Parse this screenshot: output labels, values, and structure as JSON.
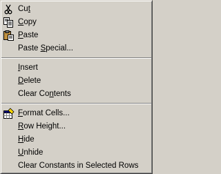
{
  "menu": {
    "items": [
      {
        "type": "item",
        "name": "menu-item-cut",
        "icon": "scissors-icon",
        "pre": "Cu",
        "key": "t",
        "post": ""
      },
      {
        "type": "item",
        "name": "menu-item-copy",
        "icon": "copy-icon",
        "pre": "",
        "key": "C",
        "post": "opy"
      },
      {
        "type": "item",
        "name": "menu-item-paste",
        "icon": "paste-icon",
        "pre": "",
        "key": "P",
        "post": "aste"
      },
      {
        "type": "item",
        "name": "menu-item-paste-special",
        "icon": null,
        "pre": "Paste ",
        "key": "S",
        "post": "pecial..."
      },
      {
        "type": "separator"
      },
      {
        "type": "item",
        "name": "menu-item-insert",
        "icon": null,
        "pre": "",
        "key": "I",
        "post": "nsert"
      },
      {
        "type": "item",
        "name": "menu-item-delete",
        "icon": null,
        "pre": "",
        "key": "D",
        "post": "elete"
      },
      {
        "type": "item",
        "name": "menu-item-clear-contents",
        "icon": null,
        "pre": "Clear Co",
        "key": "n",
        "post": "tents"
      },
      {
        "type": "separator"
      },
      {
        "type": "item",
        "name": "menu-item-format-cells",
        "icon": "format-cells-icon",
        "pre": "",
        "key": "F",
        "post": "ormat Cells..."
      },
      {
        "type": "item",
        "name": "menu-item-row-height",
        "icon": null,
        "pre": "",
        "key": "R",
        "post": "ow Height..."
      },
      {
        "type": "item",
        "name": "menu-item-hide",
        "icon": null,
        "pre": "",
        "key": "H",
        "post": "ide"
      },
      {
        "type": "item",
        "name": "menu-item-unhide",
        "icon": null,
        "pre": "",
        "key": "U",
        "post": "nhide"
      },
      {
        "type": "item",
        "name": "menu-item-clear-constants",
        "icon": null,
        "pre": "Clear Constants in Selected Rows",
        "key": "",
        "post": ""
      }
    ]
  },
  "colors": {
    "menu_background": "#d4d0c8",
    "text": "#000000",
    "separator_dark": "#808080",
    "separator_light": "#ffffff"
  }
}
